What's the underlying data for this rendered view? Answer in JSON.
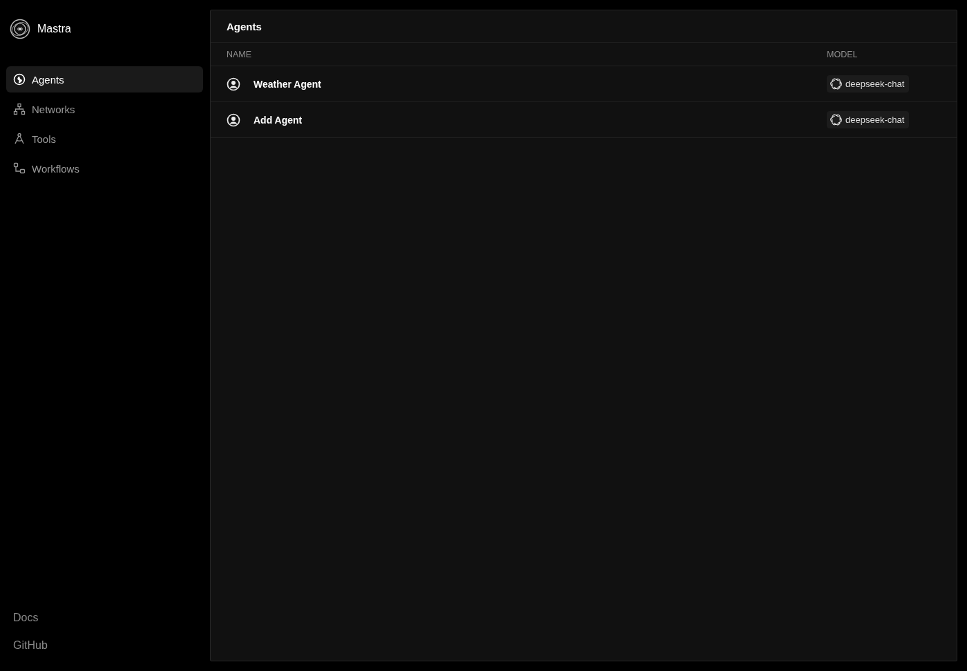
{
  "app": {
    "name": "Mastra"
  },
  "sidebar": {
    "items": [
      {
        "label": "Agents",
        "kind": "agents",
        "selected": true
      },
      {
        "label": "Networks",
        "kind": "networks",
        "selected": false
      },
      {
        "label": "Tools",
        "kind": "tools",
        "selected": false
      },
      {
        "label": "Workflows",
        "kind": "workflows",
        "selected": false
      }
    ],
    "footer_links": [
      "Docs",
      "GitHub"
    ]
  },
  "panel": {
    "title": "Agents",
    "table": {
      "columns": [
        "NAME",
        "MODEL"
      ],
      "rows": [
        {
          "name": "Weather Agent",
          "model": "deepseek-chat"
        },
        {
          "name": "Add Agent",
          "model": "deepseek-chat"
        }
      ]
    }
  }
}
